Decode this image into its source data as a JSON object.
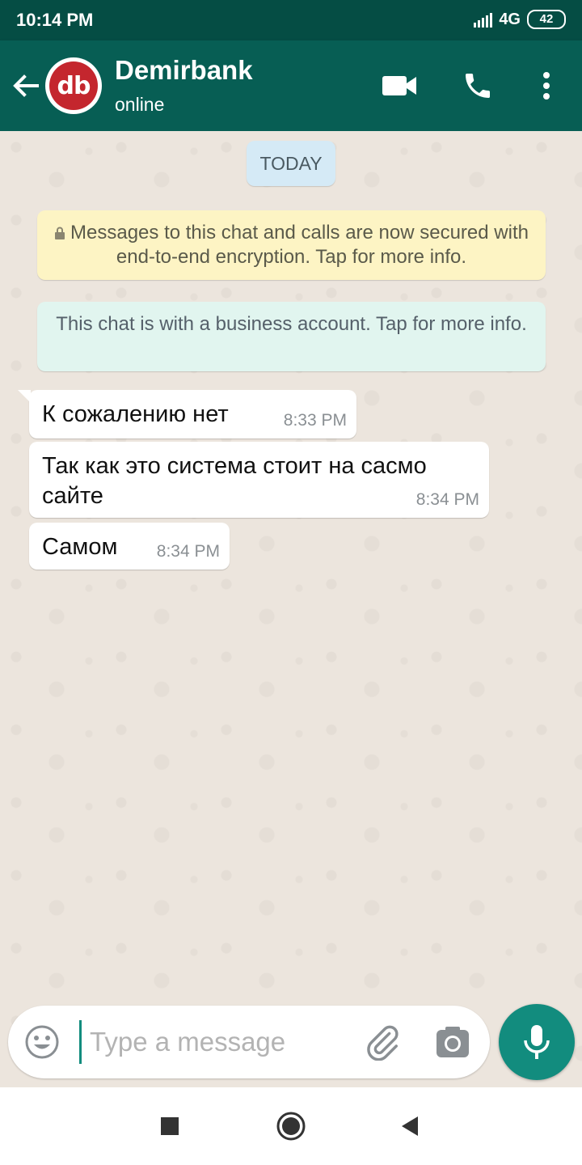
{
  "status_bar": {
    "time": "10:14 PM",
    "network": "4G",
    "battery": "42"
  },
  "header": {
    "avatar_text": "db",
    "contact_name": "Demirbank",
    "contact_status": "online",
    "icons": [
      "back-arrow-icon",
      "video-call-icon",
      "phone-icon",
      "more-vert-icon"
    ]
  },
  "chat": {
    "date_chip": "TODAY",
    "encryption_notice": "Messages to this chat and calls are now secured with end-to-end encryption. Tap for more info.",
    "business_notice": "This chat is with a business account. Tap for more info.",
    "messages": [
      {
        "text": "К сожалению нет",
        "time": "8:33 PM"
      },
      {
        "text": "Так как это система стоит на сасмо сайте",
        "time": "8:34 PM"
      },
      {
        "text": "Самом",
        "time": "8:34 PM"
      }
    ]
  },
  "composer": {
    "placeholder": "Type a message"
  },
  "colors": {
    "header": "#075e54",
    "status_bar": "#054d44",
    "accent": "#128c7e",
    "encryption_bg": "#fdf4c4",
    "business_bg": "#e1f5ef",
    "date_chip_bg": "#d5eaf6"
  }
}
